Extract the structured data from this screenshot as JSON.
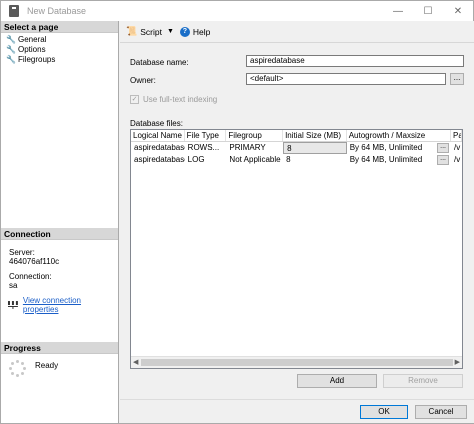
{
  "window": {
    "title": "New Database",
    "minimize": "—",
    "maximize": "☐",
    "close": "✕"
  },
  "left": {
    "select_page_header": "Select a page",
    "pages": [
      {
        "label": "General",
        "icon": "wrench-icon"
      },
      {
        "label": "Options",
        "icon": "wrench-icon"
      },
      {
        "label": "Filegroups",
        "icon": "wrench-icon"
      }
    ],
    "connection_header": "Connection",
    "server_label": "Server:",
    "server_value": "464076af110c",
    "connection_label": "Connection:",
    "connection_value": "sa",
    "view_link": "View connection properties",
    "progress_header": "Progress",
    "progress_status": "Ready"
  },
  "toolbar": {
    "script_label": "Script",
    "help_label": "Help"
  },
  "form": {
    "db_name_label": "Database name:",
    "db_name_value": "aspiredatabase",
    "owner_label": "Owner:",
    "owner_value": "<default>",
    "owner_browse": "...",
    "fulltext_label": "Use full-text indexing",
    "fulltext_checked": true,
    "files_label": "Database files:"
  },
  "grid": {
    "columns": [
      "Logical Name",
      "File Type",
      "Filegroup",
      "Initial Size (MB)",
      "Autogrowth / Maxsize",
      "Pa"
    ],
    "rows": [
      {
        "logical": "aspiredatabase",
        "type": "ROWS...",
        "filegroup": "PRIMARY",
        "size": "8",
        "autogrowth": "By 64 MB, Unlimited",
        "btn": "...",
        "path": "/v"
      },
      {
        "logical": "aspiredatabase",
        "type": "LOG",
        "filegroup": "Not Applicable",
        "size": "8",
        "autogrowth": "By 64 MB, Unlimited",
        "btn": "...",
        "path": "/v"
      }
    ]
  },
  "buttons": {
    "add": "Add",
    "remove": "Remove",
    "ok": "OK",
    "cancel": "Cancel"
  }
}
